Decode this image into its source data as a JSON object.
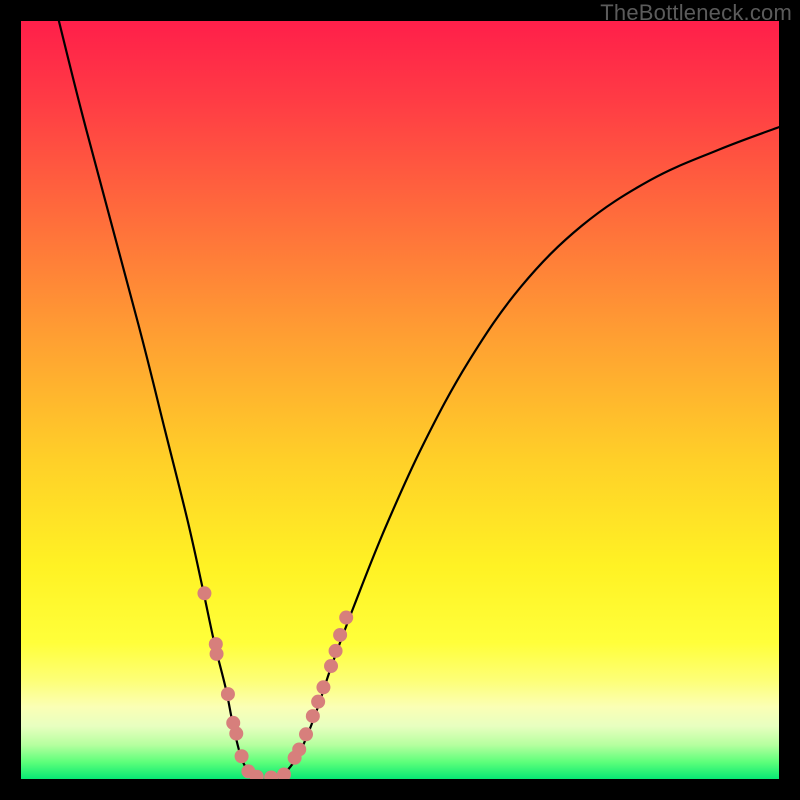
{
  "watermark": "TheBottleneck.com",
  "chart_data": {
    "type": "line",
    "title": "",
    "xlabel": "",
    "ylabel": "",
    "xlim": [
      0,
      100
    ],
    "ylim": [
      0,
      100
    ],
    "series": [
      {
        "name": "curve",
        "x": [
          5,
          8,
          12,
          16,
          19,
          22,
          24,
          25.5,
          27,
          28,
          29,
          30,
          31,
          33,
          35,
          37,
          39,
          41,
          44,
          48,
          53,
          59,
          66,
          74,
          83,
          92,
          100
        ],
        "y": [
          100,
          88,
          73,
          58,
          46,
          34,
          25,
          18,
          12,
          7,
          3,
          1,
          0,
          0,
          1,
          4,
          9,
          15,
          23,
          33,
          44,
          55,
          65,
          73,
          79,
          83,
          86
        ]
      }
    ],
    "points": {
      "name": "dots",
      "x": [
        24.2,
        25.7,
        25.8,
        27.3,
        28.0,
        28.4,
        29.1,
        30.0,
        31.1,
        33.0,
        34.7,
        36.1,
        36.7,
        37.6,
        38.5,
        39.2,
        39.9,
        40.9,
        41.5,
        42.1,
        42.9
      ],
      "y": [
        24.5,
        17.8,
        16.5,
        11.2,
        7.4,
        6.0,
        3.0,
        1.0,
        0.3,
        0.2,
        0.6,
        2.8,
        3.9,
        5.9,
        8.3,
        10.2,
        12.1,
        14.9,
        16.9,
        19.0,
        21.3
      ]
    },
    "gradient_stops": [
      {
        "offset": 0.0,
        "color": "#ff1f4a"
      },
      {
        "offset": 0.1,
        "color": "#ff3a45"
      },
      {
        "offset": 0.25,
        "color": "#ff6a3c"
      },
      {
        "offset": 0.42,
        "color": "#ffa032"
      },
      {
        "offset": 0.58,
        "color": "#ffd028"
      },
      {
        "offset": 0.72,
        "color": "#fff224"
      },
      {
        "offset": 0.82,
        "color": "#ffff3a"
      },
      {
        "offset": 0.87,
        "color": "#fdff77"
      },
      {
        "offset": 0.905,
        "color": "#fbffb5"
      },
      {
        "offset": 0.93,
        "color": "#e8ffc0"
      },
      {
        "offset": 0.955,
        "color": "#b6ff9f"
      },
      {
        "offset": 0.978,
        "color": "#5cff7a"
      },
      {
        "offset": 1.0,
        "color": "#07e874"
      }
    ],
    "dot_color": "#d77f7c"
  }
}
